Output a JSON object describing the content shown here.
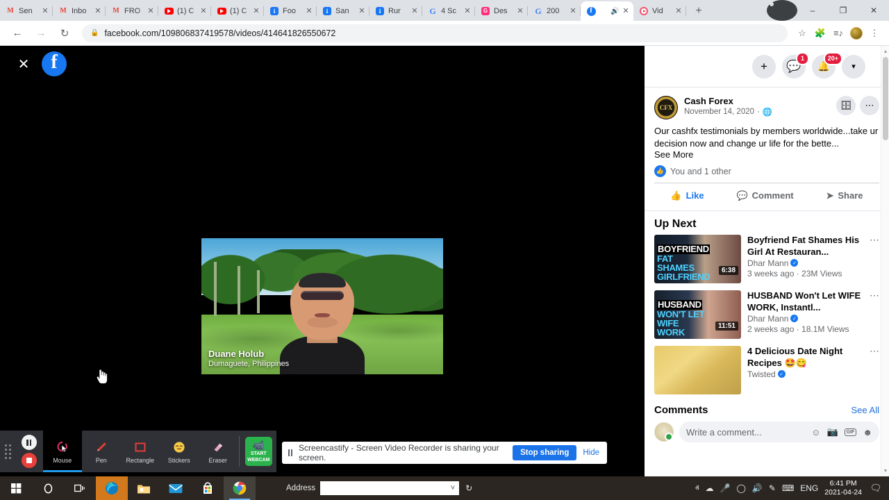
{
  "browser": {
    "tabs": [
      {
        "title": "Sen",
        "icon": "gmail-icon",
        "active": false,
        "audio": false
      },
      {
        "title": "Inbo",
        "icon": "gmail-icon",
        "active": false,
        "audio": false
      },
      {
        "title": "FRO",
        "icon": "gmail-icon",
        "active": false,
        "audio": false
      },
      {
        "title": "(1) C",
        "icon": "youtube-icon",
        "active": false,
        "audio": false
      },
      {
        "title": "(1) C",
        "icon": "youtube-icon",
        "active": false,
        "audio": false
      },
      {
        "title": "Foo",
        "icon": "info-icon",
        "active": false,
        "audio": false
      },
      {
        "title": "San",
        "icon": "info-icon",
        "active": false,
        "audio": false
      },
      {
        "title": "Rur",
        "icon": "info-icon",
        "active": false,
        "audio": false
      },
      {
        "title": "4 Sc",
        "icon": "google-icon",
        "active": false,
        "audio": false
      },
      {
        "title": "Des",
        "icon": "pink-app-icon",
        "active": false,
        "audio": false
      },
      {
        "title": "200",
        "icon": "google-icon",
        "active": false,
        "audio": false
      },
      {
        "title": "",
        "icon": "facebook-icon",
        "active": true,
        "audio": true
      },
      {
        "title": "Vid",
        "icon": "red-player-icon",
        "active": false,
        "audio": false
      }
    ],
    "new_tab_label": "+",
    "close_label": "×",
    "window_minimize": "–",
    "window_maximize": "❐",
    "window_close": "✕",
    "back_label": "←",
    "forward_label": "→",
    "reload_label": "↻",
    "url": "facebook.com/109806837419578/videos/414641826550672",
    "lock_icon": "lock-icon",
    "bookmark_icon": "star-icon",
    "extensions_icon": "puzzle-icon",
    "readinglist_icon": "playlist-icon",
    "menu_icon": "three-dot-menu-icon"
  },
  "video": {
    "close_label": "✕",
    "logo_letter": "f",
    "caption_name": "Duane Holub",
    "caption_location": "Dumaguete, Philippines"
  },
  "sidebar": {
    "header": {
      "create_label": "+",
      "messenger_badge": "1",
      "notifications_badge": "20+",
      "account_caret": "▾"
    },
    "post": {
      "avatar_text": "CFX",
      "page_name": "Cash Forex",
      "date": "November 14, 2020",
      "privacy_icon": "globe-icon",
      "save_icon": "save-post-icon",
      "more_icon": "three-dot-menu-icon",
      "body": "Our cashfx testimonials by members worldwide...take ur decision now and change ur life for the bette...",
      "see_more": "See More",
      "reactions_text": "You and 1 other",
      "actions": [
        {
          "label": "Like",
          "icon": "thumbs-up-icon",
          "active": true
        },
        {
          "label": "Comment",
          "icon": "comment-bubble-icon",
          "active": false
        },
        {
          "label": "Share",
          "icon": "share-arrow-icon",
          "active": false
        }
      ]
    },
    "up_next": {
      "title": "Up Next",
      "videos": [
        {
          "thumb_line1": "BOYFRIEND",
          "thumb_line2": "FAT SHAMES",
          "thumb_line3": "GIRLFRIEND",
          "duration": "6:38",
          "title": "Boyfriend Fat Shames His Girl At Restauran...",
          "channel": "Dhar Mann",
          "verified": true,
          "meta": "3 weeks ago · 23M Views"
        },
        {
          "thumb_line1": "HUSBAND",
          "thumb_line2": "WON'T LET",
          "thumb_line3": "WIFE WORK",
          "duration": "11:51",
          "title": "HUSBAND Won't Let WIFE WORK, Instantl...",
          "channel": "Dhar Mann",
          "verified": true,
          "meta": "2 weeks ago · 18.1M Views"
        },
        {
          "thumb_line1": "",
          "thumb_line2": "",
          "thumb_line3": "",
          "duration": "",
          "title": "4 Delicious Date Night Recipes 🤩😋",
          "channel": "Twisted",
          "verified": true,
          "meta": ""
        }
      ]
    },
    "comments": {
      "title": "Comments",
      "see_all": "See All",
      "placeholder": "Write a comment...",
      "icons": [
        "emoji-icon",
        "camera-icon",
        "gif-icon",
        "sticker-icon"
      ],
      "gif_label": "GIF"
    }
  },
  "screencastify": {
    "tools": [
      {
        "label": "Mouse",
        "icon": "mouse-cursor-icon",
        "selected": true
      },
      {
        "label": "Pen",
        "icon": "pen-icon",
        "selected": false
      },
      {
        "label": "Rectangle",
        "icon": "rectangle-icon",
        "selected": false
      },
      {
        "label": "Stickers",
        "icon": "sticker-smiley-icon",
        "selected": false
      },
      {
        "label": "Eraser",
        "icon": "eraser-icon",
        "selected": false
      }
    ],
    "webcam_line1": "START",
    "webcam_line2": "WEBCAM",
    "pause_name": "pause-button",
    "stop_name": "stop-button"
  },
  "share_notification": {
    "text": "Screencastify - Screen Video Recorder is sharing your screen.",
    "stop_label": "Stop sharing",
    "hide_label": "Hide"
  },
  "taskbar": {
    "items": [
      {
        "name": "start-button",
        "icon": "windows-logo-icon"
      },
      {
        "name": "cortana-search",
        "icon": "circle-search-icon"
      },
      {
        "name": "task-view",
        "icon": "task-view-icon"
      },
      {
        "name": "edge-browser",
        "icon": "edge-icon"
      },
      {
        "name": "file-explorer",
        "icon": "folder-icon"
      },
      {
        "name": "mail-app",
        "icon": "mail-icon"
      },
      {
        "name": "microsoft-store",
        "icon": "store-icon"
      },
      {
        "name": "chrome-browser",
        "icon": "chrome-icon"
      }
    ],
    "address_label": "Address",
    "address_value": "",
    "address_caret": "˅",
    "refresh_icon": "refresh-icon",
    "tray": {
      "overflow": "ⱏ",
      "onedrive": "cloud-icon",
      "mic": "microphone-icon",
      "network": "wifi-icon",
      "volume": "speaker-icon",
      "pen": "pen-tray-icon",
      "keyboard": "keyboard-icon",
      "language": "ENG",
      "time": "6:41 PM",
      "date": "2021-04-24",
      "action_center": "action-center-icon"
    }
  }
}
